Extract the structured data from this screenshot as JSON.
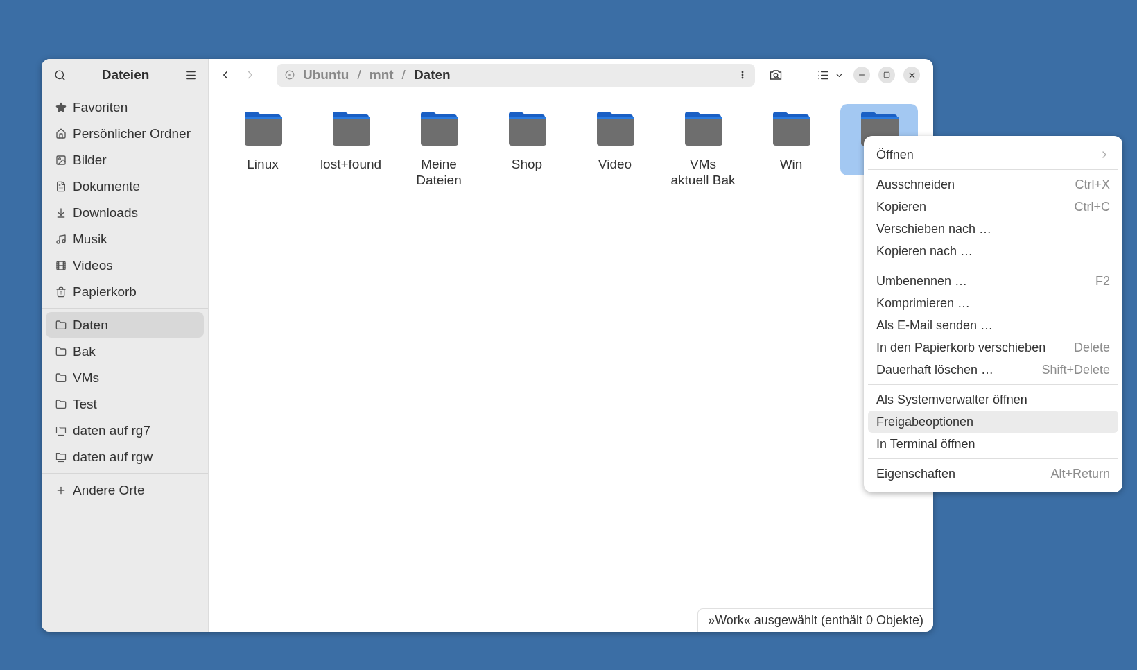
{
  "sidebar": {
    "title": "Dateien",
    "sections": [
      {
        "items": [
          {
            "label": "Favoriten",
            "kind": "star",
            "selected": false
          },
          {
            "label": "Persönlicher Ordner",
            "kind": "home",
            "selected": false
          },
          {
            "label": "Bilder",
            "kind": "image",
            "selected": false
          },
          {
            "label": "Dokumente",
            "kind": "document",
            "selected": false
          },
          {
            "label": "Downloads",
            "kind": "download",
            "selected": false
          },
          {
            "label": "Musik",
            "kind": "music",
            "selected": false
          },
          {
            "label": "Videos",
            "kind": "film",
            "selected": false
          },
          {
            "label": "Papierkorb",
            "kind": "trash",
            "selected": false
          }
        ]
      },
      {
        "items": [
          {
            "label": "Daten",
            "kind": "folder",
            "selected": true
          },
          {
            "label": "Bak",
            "kind": "folder",
            "selected": false
          },
          {
            "label": "VMs",
            "kind": "folder",
            "selected": false
          },
          {
            "label": "Test",
            "kind": "folder",
            "selected": false
          },
          {
            "label": "daten auf rg7",
            "kind": "network",
            "selected": false
          },
          {
            "label": "daten auf rgw",
            "kind": "network",
            "selected": false
          }
        ]
      },
      {
        "items": [
          {
            "label": "Andere Orte",
            "kind": "plus",
            "selected": false
          }
        ]
      }
    ]
  },
  "path": [
    {
      "label": "Ubuntu",
      "current": false
    },
    {
      "label": "mnt",
      "current": false
    },
    {
      "label": "Daten",
      "current": true
    }
  ],
  "path_separator": "/",
  "folders": [
    {
      "name": "Linux",
      "selected": false
    },
    {
      "name": "lost+found",
      "selected": false
    },
    {
      "name": "Meine\nDateien",
      "selected": false
    },
    {
      "name": "Shop",
      "selected": false
    },
    {
      "name": "Video",
      "selected": false
    },
    {
      "name": "VMs\naktuell Bak",
      "selected": false
    },
    {
      "name": "Win",
      "selected": false
    },
    {
      "selected": true
    }
  ],
  "context_menu": {
    "sections": [
      {
        "items": [
          {
            "label": "Öffnen",
            "submenu": true,
            "highlighted": false
          }
        ]
      },
      {
        "items": [
          {
            "label": "Ausschneiden",
            "shortcut": "Ctrl+X",
            "highlighted": false
          },
          {
            "label": "Kopieren",
            "shortcut": "Ctrl+C",
            "highlighted": false
          },
          {
            "label": "Verschieben nach …",
            "highlighted": false
          },
          {
            "label": "Kopieren nach …",
            "highlighted": false
          }
        ]
      },
      {
        "items": [
          {
            "label": "Umbenennen …",
            "shortcut": "F2",
            "highlighted": false
          },
          {
            "label": "Komprimieren …",
            "highlighted": false
          },
          {
            "label": "Als E-Mail senden …",
            "highlighted": false
          },
          {
            "label": "In den Papierkorb verschieben",
            "shortcut": "Delete",
            "highlighted": false
          },
          {
            "label": "Dauerhaft löschen …",
            "shortcut": "Shift+Delete",
            "highlighted": false
          }
        ]
      },
      {
        "items": [
          {
            "label": "Als Systemverwalter öffnen",
            "highlighted": false
          },
          {
            "label": "Freigabeoptionen",
            "highlighted": true
          },
          {
            "label": "In Terminal öffnen",
            "highlighted": false
          }
        ]
      },
      {
        "items": [
          {
            "label": "Eigenschaften",
            "shortcut": "Alt+Return",
            "highlighted": false
          }
        ]
      }
    ]
  },
  "status_bar": "»Work« ausgewählt (enthält 0 Objekte)"
}
